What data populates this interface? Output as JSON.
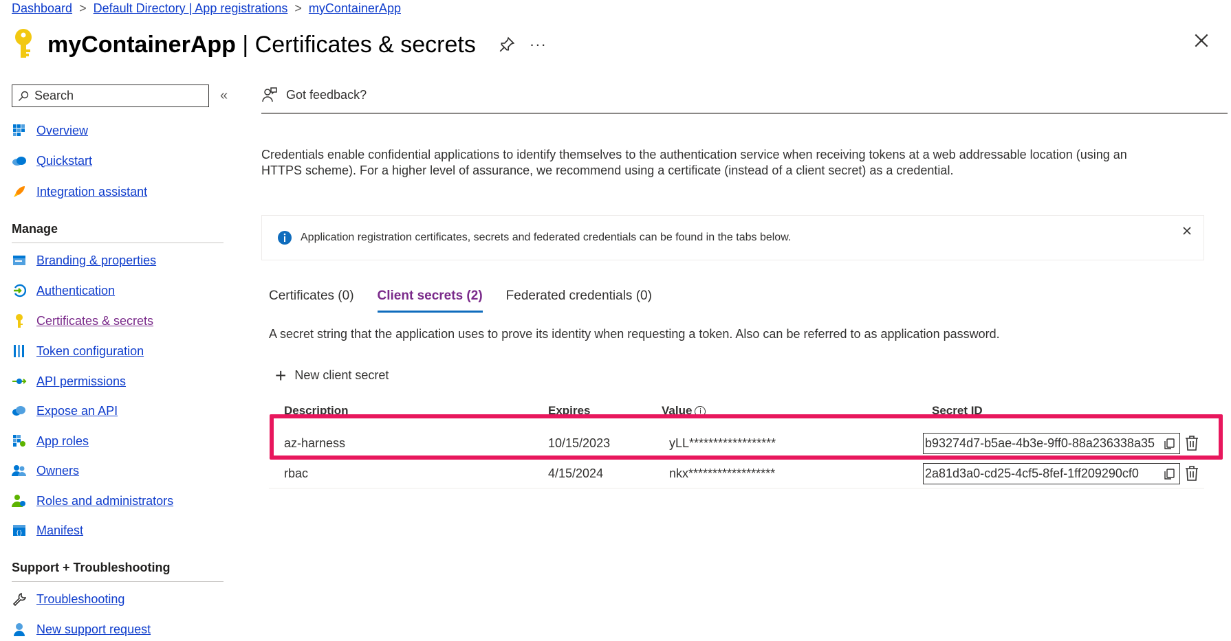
{
  "breadcrumb": {
    "items": [
      "Dashboard",
      "Default Directory | App registrations",
      "myContainerApp"
    ],
    "separator": ">"
  },
  "header": {
    "app_name": "myContainerApp",
    "page_name": "| Certificates & secrets",
    "more": "···"
  },
  "sidebar": {
    "search_placeholder": "Search",
    "collapse": "«",
    "top_items": [
      {
        "label": "Overview",
        "icon": "overview-grid-icon"
      },
      {
        "label": "Quickstart",
        "icon": "quickstart-cloud-icon"
      },
      {
        "label": "Integration assistant",
        "icon": "rocket-icon"
      }
    ],
    "manage_title": "Manage",
    "manage_items": [
      {
        "label": "Branding & properties",
        "icon": "branding-icon"
      },
      {
        "label": "Authentication",
        "icon": "authentication-icon"
      },
      {
        "label": "Certificates & secrets",
        "icon": "key-icon",
        "active": true
      },
      {
        "label": "Token configuration",
        "icon": "token-bars-icon"
      },
      {
        "label": "API permissions",
        "icon": "api-permissions-icon"
      },
      {
        "label": "Expose an API",
        "icon": "cloud-icon"
      },
      {
        "label": "App roles",
        "icon": "app-roles-grid-icon"
      },
      {
        "label": "Owners",
        "icon": "owners-people-icon"
      },
      {
        "label": "Roles and administrators",
        "icon": "roles-person-icon"
      },
      {
        "label": "Manifest",
        "icon": "manifest-icon"
      }
    ],
    "support_title": "Support + Troubleshooting",
    "support_items": [
      {
        "label": "Troubleshooting",
        "icon": "wrench-icon"
      },
      {
        "label": "New support request",
        "icon": "support-person-icon"
      }
    ]
  },
  "main": {
    "feedback_label": "Got feedback?",
    "description": "Credentials enable confidential applications to identify themselves to the authentication service when receiving tokens at a web addressable location (using an HTTPS scheme). For a higher level of assurance, we recommend using a certificate (instead of a client secret) as a credential.",
    "info_banner": "Application registration certificates, secrets and federated credentials can be found in the tabs below.",
    "tabs": [
      {
        "label": "Certificates (0)",
        "active": false
      },
      {
        "label": "Client secrets (2)",
        "active": true
      },
      {
        "label": "Federated credentials (0)",
        "active": false
      }
    ],
    "tab_description": "A secret string that the application uses to prove its identity when requesting a token. Also can be referred to as application password.",
    "new_secret_label": "New client secret",
    "table": {
      "headers": {
        "description": "Description",
        "expires": "Expires",
        "value": "Value",
        "value_info": "i",
        "secret_id": "Secret ID"
      },
      "rows": [
        {
          "description": "az-harness",
          "expires": "10/15/2023",
          "value": "yLL******************",
          "secret_id": "b93274d7-b5ae-4b3e-9ff0-88a236338a35",
          "highlighted": true
        },
        {
          "description": "rbac",
          "expires": "4/15/2024",
          "value": "nkx******************",
          "secret_id": "2a81d3a0-cd25-4cf5-8fef-1ff209290cf0",
          "highlighted": false
        }
      ]
    }
  },
  "colors": {
    "link": "#0f3dcc",
    "active_nav": "#7a2a8a",
    "highlight_border": "#e8175d",
    "tab_underline": "#0f6cbd",
    "key_yellow": "#f2c811",
    "info_blue": "#0f6cbd"
  }
}
